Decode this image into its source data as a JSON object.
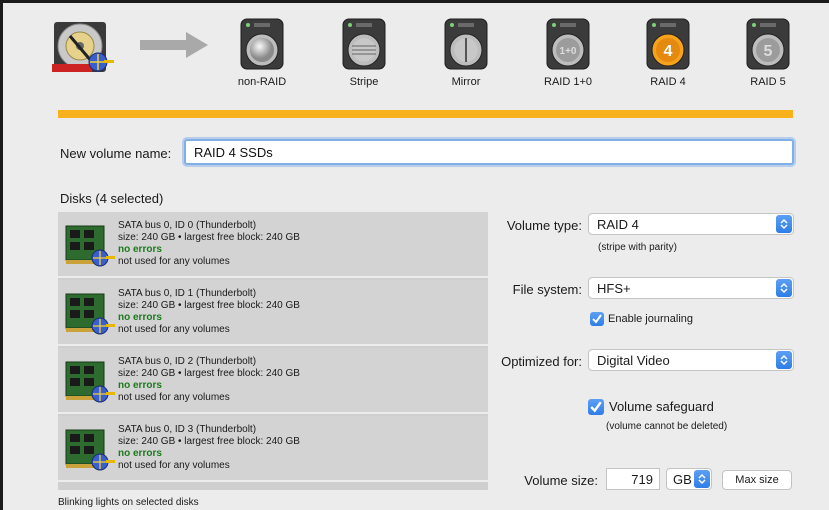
{
  "raid_options": [
    {
      "label": "non-RAID",
      "glyph": ""
    },
    {
      "label": "Stripe",
      "glyph": ""
    },
    {
      "label": "Mirror",
      "glyph": ""
    },
    {
      "label": "RAID 1+0",
      "glyph": "1+0"
    },
    {
      "label": "RAID 4",
      "glyph": "4"
    },
    {
      "label": "RAID 5",
      "glyph": "5"
    }
  ],
  "selected_raid": "RAID 4",
  "colors": {
    "accent_bar": "#f7b21b",
    "selected_ring": "#f7a21b",
    "ok_text": "#1b7a1b",
    "control_blue": "#2e7de6"
  },
  "icons": {
    "source": "hard-disk-icon",
    "arrow": "arrow-right-icon",
    "disk": "ssd-disk-icon"
  },
  "volume_name": {
    "label": "New volume name:",
    "value": "RAID 4 SSDs"
  },
  "disks": {
    "title": "Disks (4 selected)",
    "items": [
      {
        "name": "SATA bus 0, ID 0 (Thunderbolt)",
        "size": "size: 240 GB • largest free block: 240 GB",
        "status": "no errors",
        "usage": "not used for any volumes"
      },
      {
        "name": "SATA bus 0, ID 1 (Thunderbolt)",
        "size": "size: 240 GB • largest free block: 240 GB",
        "status": "no errors",
        "usage": "not used for any volumes"
      },
      {
        "name": "SATA bus 0, ID 2 (Thunderbolt)",
        "size": "size: 240 GB • largest free block: 240 GB",
        "status": "no errors",
        "usage": "not used for any volumes"
      },
      {
        "name": "SATA bus 0, ID 3 (Thunderbolt)",
        "size": "size: 240 GB • largest free block: 240 GB",
        "status": "no errors",
        "usage": "not used for any volumes"
      }
    ],
    "footer": "Blinking lights on selected disks"
  },
  "volume_type": {
    "label": "Volume type:",
    "value": "RAID 4",
    "note": "(stripe with parity)"
  },
  "file_system": {
    "label": "File system:",
    "value": "HFS+",
    "journaling_label": "Enable journaling",
    "journaling_checked": true
  },
  "optimized_for": {
    "label": "Optimized for:",
    "value": "Digital Video"
  },
  "safeguard": {
    "label": "Volume safeguard",
    "checked": true,
    "note": "(volume cannot be deleted)"
  },
  "volume_size": {
    "label": "Volume size:",
    "value": "719",
    "unit": "GB",
    "max_button": "Max size"
  }
}
